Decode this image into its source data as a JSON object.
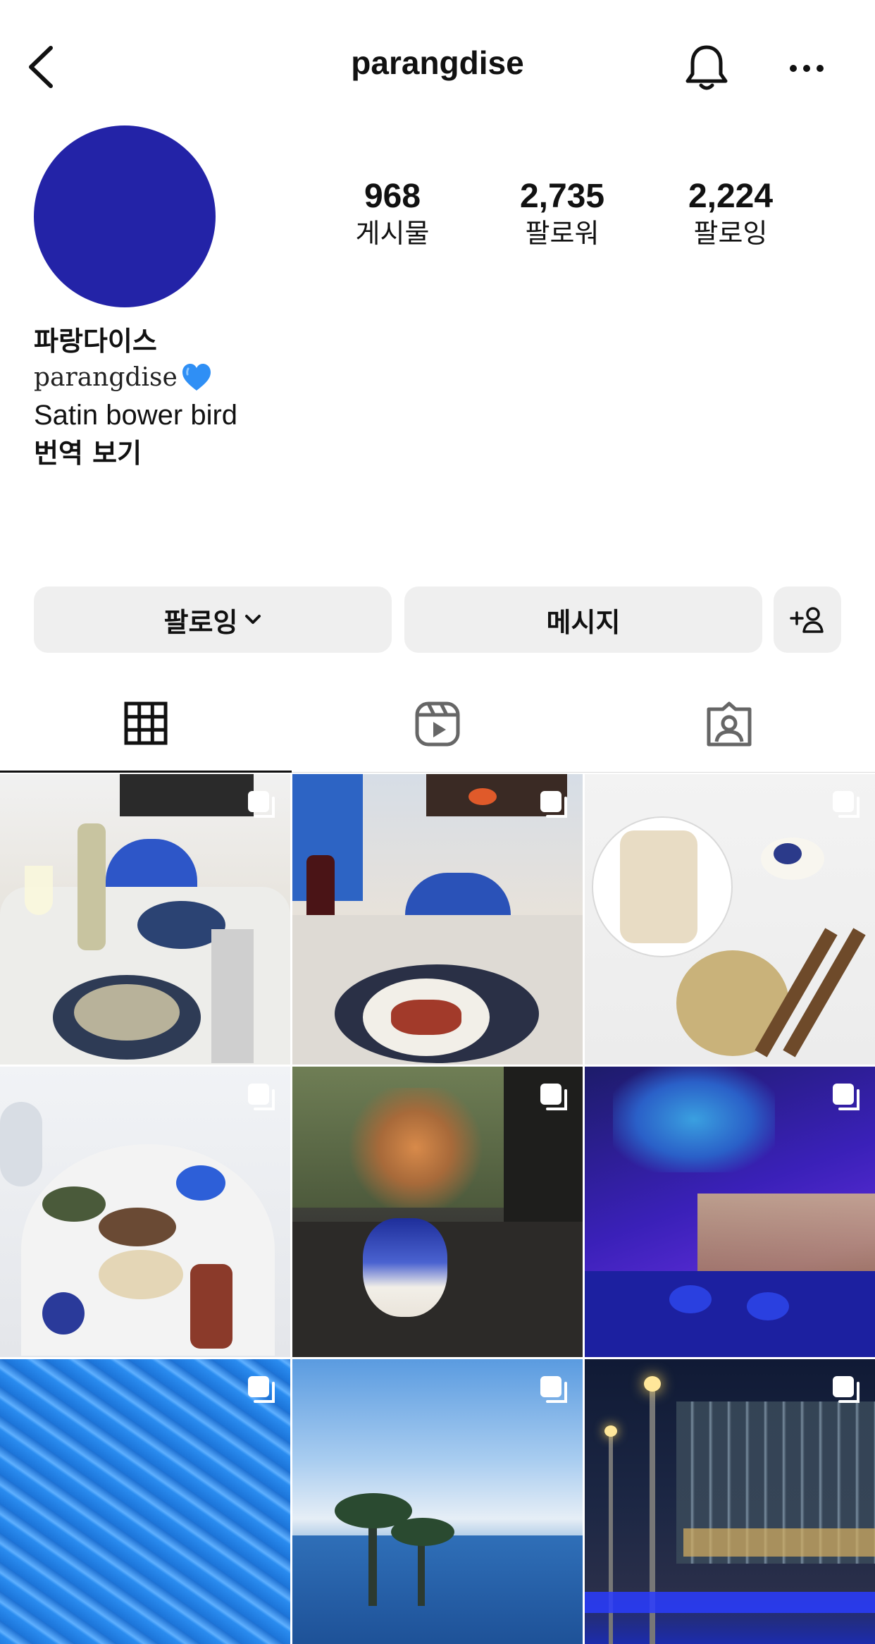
{
  "header": {
    "title": "parangdise"
  },
  "profile": {
    "stats": [
      {
        "value": "968",
        "label": "게시물"
      },
      {
        "value": "2,735",
        "label": "팔로워"
      },
      {
        "value": "2,224",
        "label": "팔로잉"
      }
    ],
    "name": "파랑다이스",
    "handle": "parangdise",
    "description": "Satin bower bird",
    "translate_label": "번역 보기",
    "avatar_color": "#2323a7"
  },
  "actions": {
    "following_label": "팔로잉",
    "message_label": "메시지"
  },
  "tabs": [
    "grid-icon",
    "reels-icon",
    "tagged-icon"
  ],
  "posts": [
    {
      "type": "multi",
      "subject": "dinner table with wine and clams"
    },
    {
      "type": "multi",
      "subject": "red wine dinner"
    },
    {
      "type": "multi",
      "subject": "wraps and salad"
    },
    {
      "type": "multi",
      "subject": "set dining table"
    },
    {
      "type": "multi",
      "subject": "flowers in blue teapot"
    },
    {
      "type": "multi",
      "subject": "purple lit lounge"
    },
    {
      "type": "multi",
      "subject": "pool water"
    },
    {
      "type": "multi",
      "subject": "infinity pool with palm trees"
    },
    {
      "type": "multi",
      "subject": "building at night"
    }
  ]
}
